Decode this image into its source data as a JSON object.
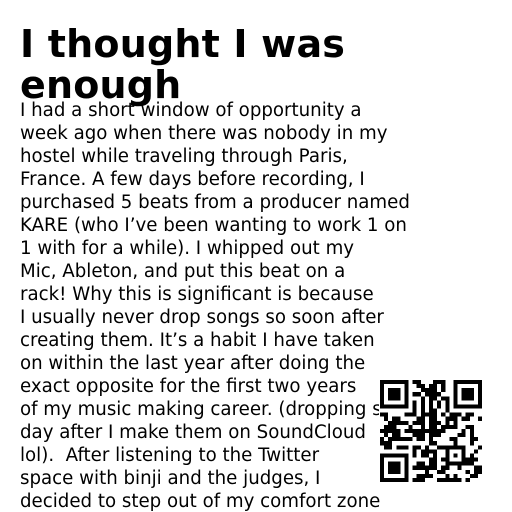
{
  "article": {
    "title_lines": [
      "I thought I was",
      "enough"
    ],
    "body_lines": [
      "I had a short window of opportunity a",
      "week ago when there was nobody in my",
      "hostel while traveling through Paris,",
      "France. A few days before recording, I",
      "purchased 5 beats from a producer named",
      "KARE (who I’ve been wanting to work 1 on",
      "1 with for a while). I whipped out my",
      "Mic, Ableton, and put this beat on a",
      "rack! Why this is significant is because",
      "I usually never drop songs so soon after",
      "creating them. It’s a habit I have taken",
      "on within the last year after doing the",
      "exact opposite for the first two years",
      "of my music making career. (dropping songs a",
      "day after I make them on SoundCloud",
      "lol).  After listening to the Twitter",
      "space with binji and the judges, I",
      "decided to step out of my comfort zone"
    ]
  },
  "qr_code": {
    "icon": "qr-code-icon",
    "color": "#000000",
    "background": "#ffffff"
  }
}
